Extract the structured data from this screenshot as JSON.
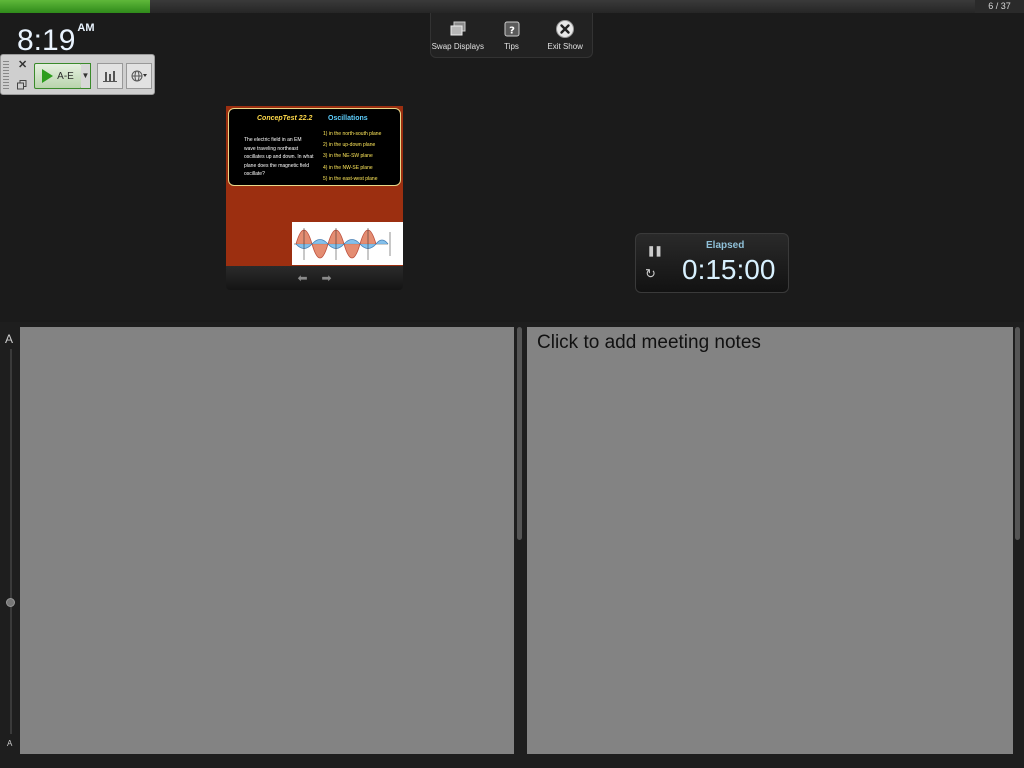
{
  "presentation": {
    "slide_counter": "6 / 37",
    "progress_fraction": 0.154
  },
  "clock": {
    "time": "8:19",
    "ampm": "AM"
  },
  "toolbar": {
    "swap_label": "Swap Displays",
    "tips_label": "Tips",
    "exit_label": "Exit Show"
  },
  "poll_widget": {
    "run_label": "A-E",
    "icons": [
      "close-icon",
      "copy-icon",
      "play-icon",
      "dropdown-arrow-icon",
      "bar-chart-icon",
      "globe-icon"
    ]
  },
  "current_slide": {
    "title": "ConcepTest 22.2",
    "topic": "Oscillations",
    "question": "The electric field in an EM wave traveling northeast oscillates up and down. In what plane does the magnetic field oscillate?",
    "options": [
      "1)  in the north-south plane",
      "2)  in the up-down plane",
      "3)  in the NE-SW plane",
      "4)  in the NW-SE plane",
      "5)  in the east-west plane"
    ],
    "colors": {
      "background": "#9c2f10",
      "title": "#ffd94a",
      "topic": "#5fd0ff",
      "options": "#ffe85a"
    }
  },
  "slide_nav": {
    "prev_icon": "arrow-left-icon",
    "next_icon": "arrow-right-icon"
  },
  "timer": {
    "label": "Elapsed",
    "value": "0:15:00",
    "pause_icon": "pause-icon",
    "reset_icon": "reset-icon"
  },
  "font_size": {
    "large_label": "A",
    "small_label": "A"
  },
  "notes": {
    "placeholder": "Click to add meeting notes"
  }
}
